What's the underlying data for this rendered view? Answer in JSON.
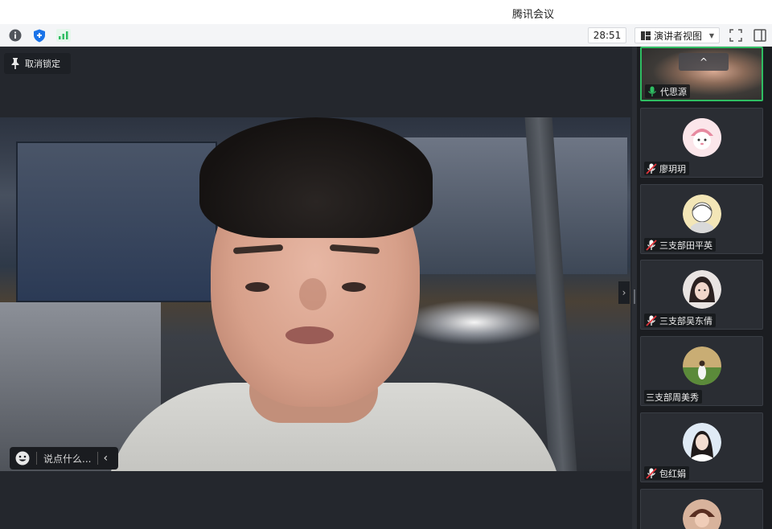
{
  "window": {
    "title": "腾讯会议"
  },
  "toolbar": {
    "info_icon": "info-icon",
    "shield_icon": "shield-icon",
    "signal_icon": "signal-icon",
    "timer": "28:51",
    "view_label": "演讲者视图",
    "view_icon": "layout-icon",
    "fullscreen_icon": "fullscreen-icon",
    "sidebar_icon": "sidebar-toggle-icon"
  },
  "stage": {
    "unlock_label": "取消锁定",
    "chat_placeholder": "说点什么..."
  },
  "participants": [
    {
      "name": "代思源",
      "mic": "on"
    },
    {
      "name": "廖玥玥",
      "mic": "muted"
    },
    {
      "name": "三支部田平英",
      "mic": "muted"
    },
    {
      "name": "三支部吴东倩",
      "mic": "muted"
    },
    {
      "name": "三支部周美秀",
      "mic": "none"
    },
    {
      "name": "包红娟",
      "mic": "muted"
    }
  ],
  "colors": {
    "accent_green": "#2fbd62",
    "bg_dark": "#24272d",
    "mic_red": "#e2343b"
  }
}
